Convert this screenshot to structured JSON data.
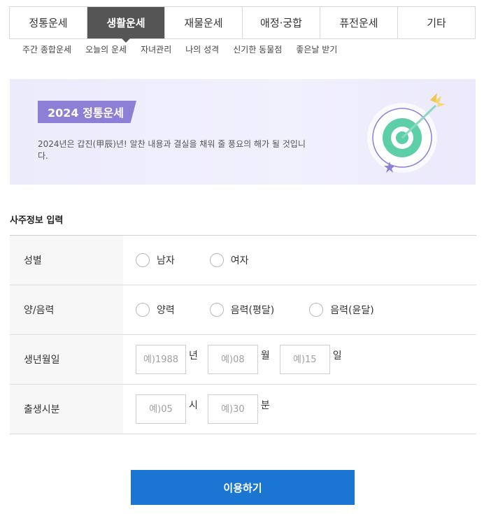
{
  "tabs": [
    {
      "label": "정통운세",
      "active": false
    },
    {
      "label": "생활운세",
      "active": true
    },
    {
      "label": "재물운세",
      "active": false
    },
    {
      "label": "애정·궁합",
      "active": false
    },
    {
      "label": "퓨전운세",
      "active": false
    },
    {
      "label": "기타",
      "active": false
    }
  ],
  "subnav": [
    "주간 종합운세",
    "오늘의 운세",
    "자녀관리",
    "나의 성격",
    "신기한 동물점",
    "좋은날 받기"
  ],
  "banner": {
    "badge": "2024 정통운세",
    "description": "2024년은 갑진(甲辰)년! 알찬 내용과 결실을 채워 줄 풍요의 해가 될 것입니다.",
    "icon": "target-arrow-icon"
  },
  "section_title": "사주정보 입력",
  "form": {
    "gender": {
      "label": "성별",
      "options": [
        "남자",
        "여자"
      ]
    },
    "calendar": {
      "label": "양/음력",
      "options": [
        "양력",
        "음력(평달)",
        "음력(윤달)"
      ]
    },
    "birthdate": {
      "label": "생년월일",
      "year_placeholder": "예)1988",
      "year_unit": "년",
      "month_placeholder": "예)08",
      "month_unit": "월",
      "day_placeholder": "예)15",
      "day_unit": "일"
    },
    "birthtime": {
      "label": "출생시분",
      "hour_placeholder": "예)05",
      "hour_unit": "시",
      "minute_placeholder": "예)30",
      "minute_unit": "분"
    }
  },
  "submit_label": "이용하기",
  "colors": {
    "active_tab": "#555555",
    "badge": "#8d7fd6",
    "submit": "#1b76d3",
    "banner_bg": "#ecebfb"
  }
}
